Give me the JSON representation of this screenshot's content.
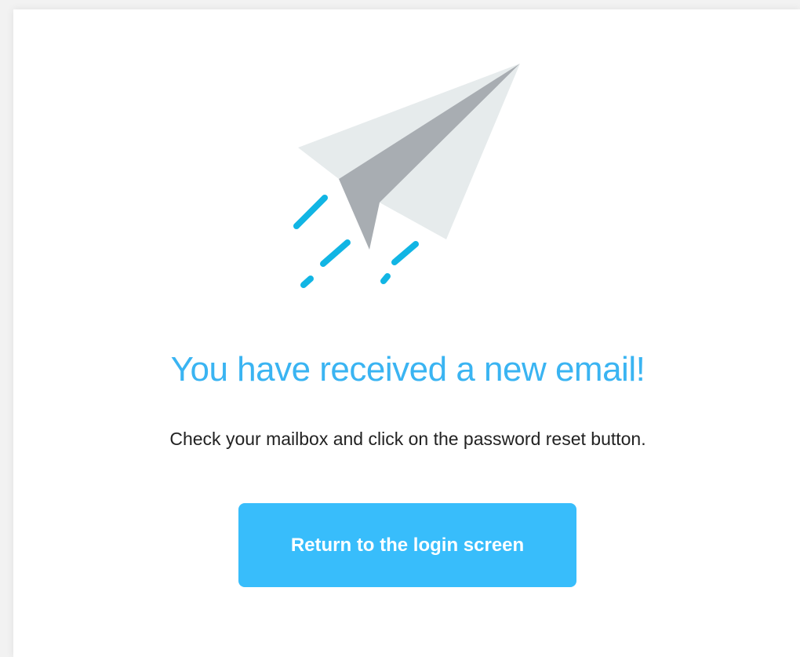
{
  "confirmation": {
    "icon": "paper-plane-icon",
    "title": "You have received a new email!",
    "message": "Check your mailbox and click on the password reset button.",
    "button_label": "Return to the login screen"
  },
  "colors": {
    "accent": "#38bdfb",
    "title": "#3ab4f2",
    "speed_lines": "#11b5e4",
    "plane_light": "#e6ebec",
    "plane_dark": "#a8adb2"
  }
}
